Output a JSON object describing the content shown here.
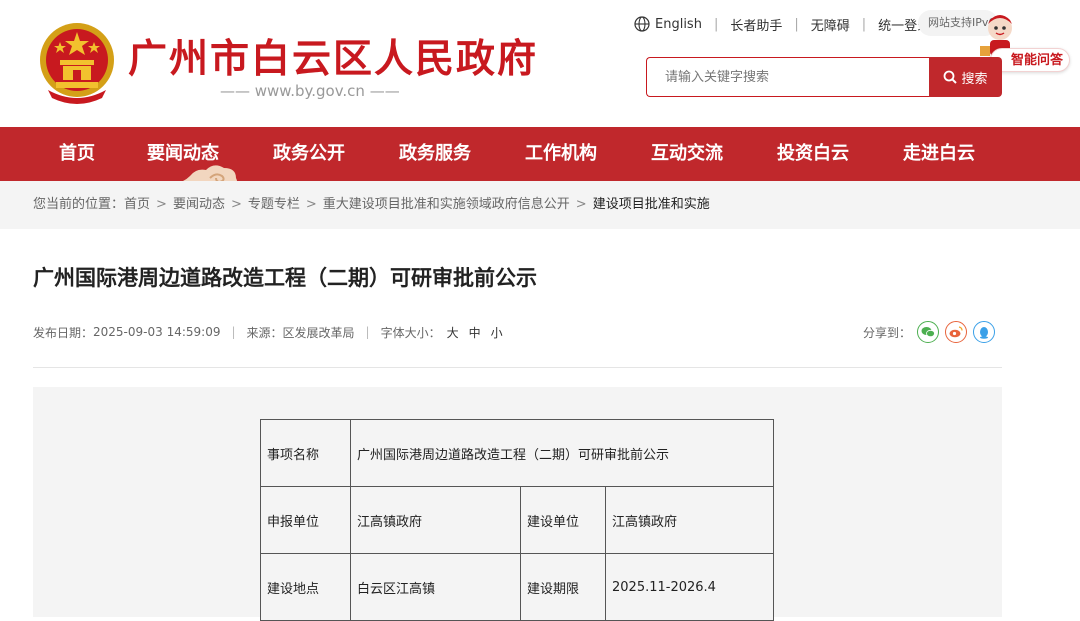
{
  "header": {
    "site_title": "广州市白云区人民政府",
    "site_url": "—— www.by.gov.cn ——",
    "links": {
      "english": "English",
      "elder": "长者助手",
      "accessible": "无障碍",
      "login": "统一登录"
    },
    "ipv6": "网站支持IPv6",
    "assistant": "智能问答",
    "search_placeholder": "请输入关键字搜索",
    "search_button": "搜索"
  },
  "nav": {
    "items": [
      "首页",
      "要闻动态",
      "政务公开",
      "政务服务",
      "工作机构",
      "互动交流",
      "投资白云",
      "走进白云"
    ]
  },
  "breadcrumb": {
    "prefix": "您当前的位置：",
    "items": [
      "首页",
      "要闻动态",
      "专题专栏",
      "重大建设项目批准和实施领域政府信息公开",
      "建设项目批准和实施"
    ],
    "separator": ">"
  },
  "article": {
    "title": "广州国际港周边道路改造工程（二期）可研审批前公示",
    "publish_label": "发布日期：",
    "publish_date": "2025-09-03 14:59:09",
    "source_label": "来源：",
    "source": "区发展改革局",
    "fontsize_label": "字体大小：",
    "fontsize_large": "大",
    "fontsize_medium": "中",
    "fontsize_small": "小",
    "share_label": "分享到："
  },
  "table": {
    "item_name_label": "事项名称",
    "item_name": "广州国际港周边道路改造工程（二期）可研审批前公示",
    "applicant_label": "申报单位",
    "applicant": "江高镇政府",
    "builder_label": "建设单位",
    "builder": "江高镇政府",
    "location_label": "建设地点",
    "location": "白云区江高镇",
    "period_label": "建设期限",
    "period": "2025.11-2026.4"
  },
  "colors": {
    "brand_red": "#c0282c",
    "title_red": "#c8191f",
    "wechat": "#4caf50",
    "weibo": "#e8643c",
    "qq": "#3aa0e8"
  }
}
